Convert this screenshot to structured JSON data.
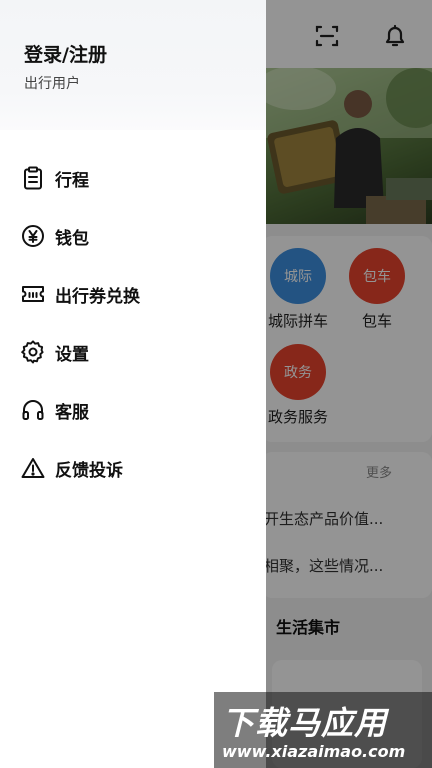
{
  "drawer": {
    "login_title": "登录/注册",
    "user_type": "出行用户",
    "menu": [
      {
        "label": "行程",
        "icon": "clipboard-icon"
      },
      {
        "label": "钱包",
        "icon": "yuan-circle-icon"
      },
      {
        "label": "出行券兑换",
        "icon": "ticket-icon"
      },
      {
        "label": "设置",
        "icon": "gear-icon"
      },
      {
        "label": "客服",
        "icon": "headset-icon"
      },
      {
        "label": "反馈投诉",
        "icon": "warning-triangle-icon"
      }
    ]
  },
  "background": {
    "header_icons": [
      "scan-icon",
      "bell-icon"
    ],
    "services": [
      {
        "label": "城际拼车",
        "badge": "城际",
        "color": "#3d8fe0"
      },
      {
        "label": "包车",
        "badge": "包车",
        "color": "#e8442e"
      },
      {
        "label": "政务服务",
        "badge": "政务",
        "color": "#e8442e"
      }
    ],
    "news": {
      "more": "更多",
      "items": [
        "开生态产品价值...",
        "相聚，这些情况..."
      ]
    },
    "market_title": "生活集市"
  },
  "watermark": {
    "logo": "下载马应用",
    "url": "www.xiazaimao.com"
  }
}
